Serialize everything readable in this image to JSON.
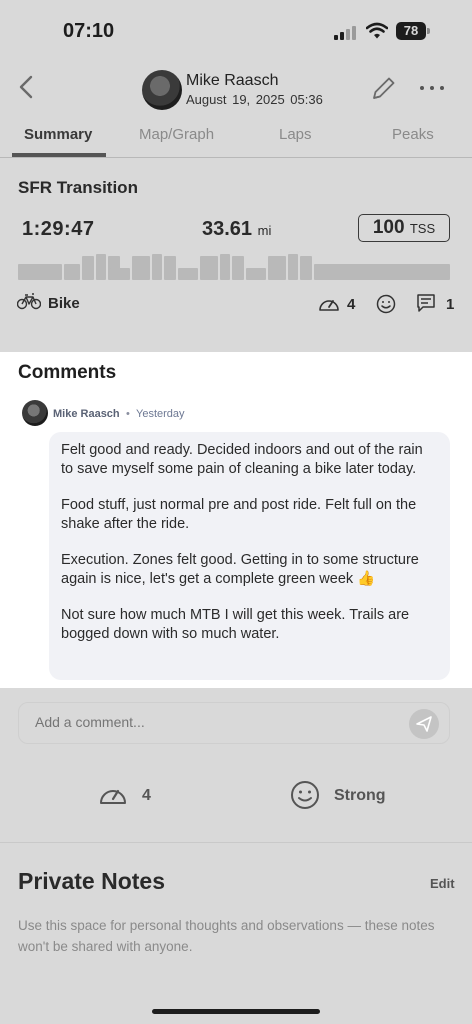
{
  "status": {
    "time": "07:10",
    "battery": "78"
  },
  "header": {
    "name": "Mike Raasch",
    "date": "August 19, 2025   05:36"
  },
  "tabs": [
    {
      "label": "Summary",
      "active": true
    },
    {
      "label": "Map/Graph",
      "active": false
    },
    {
      "label": "Laps",
      "active": false
    },
    {
      "label": "Peaks",
      "active": false
    }
  ],
  "activity": {
    "title": "SFR Transition",
    "duration": "1:29:47",
    "distance": "33.61",
    "distance_unit": "mi",
    "tss": "100",
    "tss_label": "TSS",
    "sport": "Bike",
    "effort": "4",
    "comment_count": "1"
  },
  "comments": {
    "title": "Comments",
    "items": [
      {
        "author": "Mike Raasch",
        "separator": "•",
        "when": "Yesterday",
        "paragraphs": [
          "Felt good and ready. Decided indoors and out of the rain to save myself some pain of cleaning a bike later today.",
          "Food stuff, just normal pre and post ride. Felt full on the shake after the ride.",
          "Execution. Zones felt good. Getting in to some structure again is nice, let's get a complete green week 👍",
          "Not sure how much MTB I will get this week. Trails are bogged down with so much water."
        ]
      }
    ],
    "add_placeholder": "Add a comment..."
  },
  "rating": {
    "effort": "4",
    "feel": "Strong"
  },
  "private_notes": {
    "title": "Private Notes",
    "edit": "Edit",
    "placeholder": "Use this space for personal thoughts and observations — these notes won't be shared with anyone."
  },
  "colors": {
    "panel": "#ffffff",
    "dimmed_background": "#d9d9d9",
    "bubble": "#f1f2f6",
    "author": "#5a6275"
  }
}
